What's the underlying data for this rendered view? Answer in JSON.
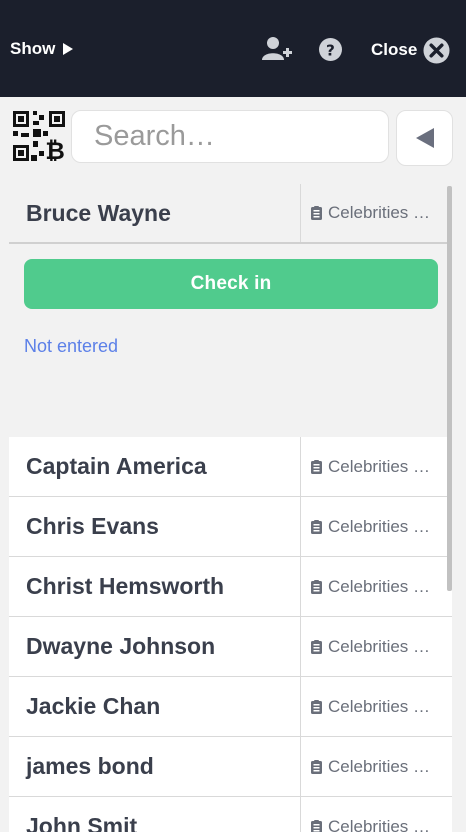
{
  "header": {
    "show_label": "Show",
    "close_label": "Close",
    "icons": {
      "show": "play-triangle-icon",
      "add_user": "add-user-icon",
      "help": "question-circle-icon",
      "close": "close-circle-icon"
    }
  },
  "search": {
    "placeholder": "Search…",
    "value": ""
  },
  "selected": {
    "name": "Bruce Wayne",
    "category": "Celebrities …",
    "checkin_label": "Check in",
    "status": "Not entered"
  },
  "guests": [
    {
      "name": "Captain America",
      "category": "Celebrities …"
    },
    {
      "name": "Chris Evans",
      "category": "Celebrities …"
    },
    {
      "name": "Christ Hemsworth",
      "category": "Celebrities …"
    },
    {
      "name": "Dwayne Johnson",
      "category": "Celebrities …"
    },
    {
      "name": "Jackie Chan",
      "category": "Celebrities …"
    },
    {
      "name": "james bond",
      "category": "Celebrities …"
    },
    {
      "name": "John Smit",
      "category": "Celebrities …"
    }
  ],
  "colors": {
    "header_bg": "#1b1f2c",
    "checkin_green": "#50cb8d",
    "status_blue": "#5c80e8",
    "name_text": "#3a3f4c"
  }
}
